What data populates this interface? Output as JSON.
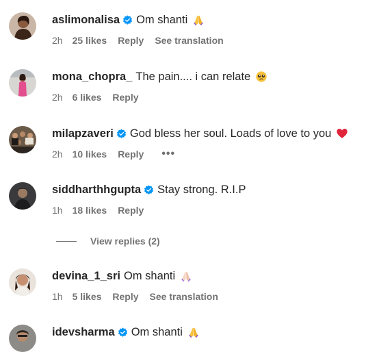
{
  "comments": [
    {
      "username": "aslimonalisa",
      "verified": true,
      "text": "Om shanti",
      "emoji": "folded-hands-emoji",
      "time": "2h",
      "likes": "25 likes",
      "reply": "Reply",
      "translate": "See translation"
    },
    {
      "username": "mona_chopra_",
      "verified": false,
      "text": "The pain.... i can relate",
      "emoji": "pleading-face-emoji",
      "time": "2h",
      "likes": "6 likes",
      "reply": "Reply"
    },
    {
      "username": "milapzaveri",
      "verified": true,
      "text": "God bless her soul. Loads of love to you",
      "emoji": "red-heart-emoji",
      "time": "2h",
      "likes": "10 likes",
      "reply": "Reply",
      "more": "•••"
    },
    {
      "username": "siddharthhgupta",
      "verified": true,
      "text": "Stay strong. R.I.P",
      "time": "1h",
      "likes": "18 likes",
      "reply": "Reply"
    },
    {
      "username": "devina_1_sri",
      "verified": false,
      "text": "Om shanti",
      "emoji": "folded-hands-light-emoji",
      "time": "1h",
      "likes": "5 likes",
      "reply": "Reply",
      "translate": "See translation"
    },
    {
      "username": "idevsharma",
      "verified": true,
      "text": "Om shanti",
      "emoji": "folded-hands-emoji"
    }
  ],
  "view_replies": "View replies (2)",
  "colors": {
    "verified": "#0095f6",
    "meta": "#737373",
    "text": "#262626",
    "heart": "#e0243a",
    "emoji_yellow": "#f7c23c"
  }
}
